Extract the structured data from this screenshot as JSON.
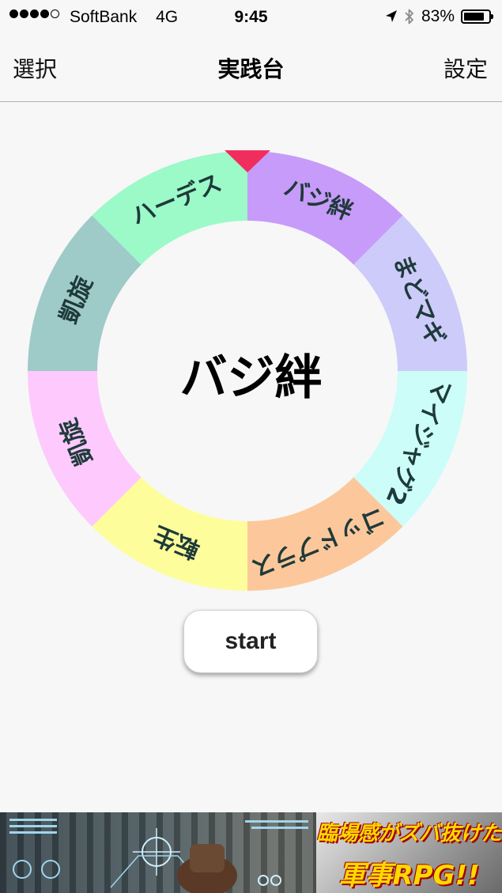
{
  "status_bar": {
    "carrier": "SoftBank",
    "network": "4G",
    "time": "9:45",
    "battery": "83%",
    "battery_level": 0.83,
    "signal_bars": 4,
    "signal_max": 5,
    "icons": [
      "location-arrow-icon",
      "bluetooth-icon",
      "battery-icon"
    ]
  },
  "nav": {
    "left": "選択",
    "title": "実践台",
    "right": "設定"
  },
  "roulette": {
    "selected": "バジ絆",
    "segments": [
      {
        "label": "バジ絆",
        "color": "#c79bf9"
      },
      {
        "label": "まどマギ",
        "color": "#cccbfa"
      },
      {
        "label": "マイジャグ2",
        "color": "#ccfdf8"
      },
      {
        "label": "ゴッドプラス",
        "color": "#fcc89b"
      },
      {
        "label": "転生",
        "color": "#fdfe9b"
      },
      {
        "label": "凱旋",
        "color": "#fec9fc"
      },
      {
        "label": "凱旋",
        "color": "#9ecac8"
      },
      {
        "label": "ハーデス",
        "color": "#9cf9c8"
      }
    ],
    "pointer_color": "#f02e5e",
    "label_color": "#1e3a3a"
  },
  "start_button": {
    "label": "start"
  },
  "ad": {
    "line1": "臨場感がズバ抜けた",
    "line2": "軍事RPG!!"
  }
}
